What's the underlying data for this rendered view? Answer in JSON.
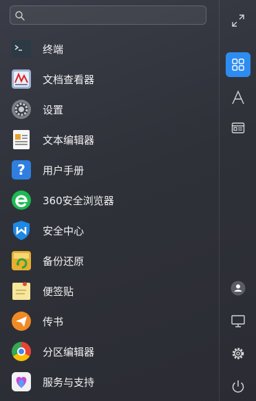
{
  "search": {
    "placeholder": "",
    "value": ""
  },
  "apps": [
    {
      "label": "终端",
      "icon": "terminal-icon"
    },
    {
      "label": "文档查看器",
      "icon": "document-viewer-icon"
    },
    {
      "label": "设置",
      "icon": "settings-gear-icon"
    },
    {
      "label": "文本编辑器",
      "icon": "text-editor-icon"
    },
    {
      "label": "用户手册",
      "icon": "help-manual-icon"
    },
    {
      "label": "360安全浏览器",
      "icon": "360-browser-icon"
    },
    {
      "label": "安全中心",
      "icon": "security-center-icon"
    },
    {
      "label": "备份还原",
      "icon": "backup-restore-icon"
    },
    {
      "label": "便签贴",
      "icon": "sticky-note-icon"
    },
    {
      "label": "传书",
      "icon": "transfer-icon"
    },
    {
      "label": "分区编辑器",
      "icon": "partition-editor-icon"
    },
    {
      "label": "服务与支持",
      "icon": "service-support-icon"
    }
  ],
  "sidebar": {
    "buttons": [
      {
        "icon": "expand-icon",
        "active": false
      },
      {
        "icon": "grid-view-icon",
        "active": true
      },
      {
        "icon": "letter-a-icon",
        "active": false
      },
      {
        "icon": "category-view-icon",
        "active": false
      },
      {
        "icon": "user-icon",
        "active": false
      },
      {
        "icon": "monitor-icon",
        "active": false
      },
      {
        "icon": "gear-icon",
        "active": false
      },
      {
        "icon": "power-icon",
        "active": false
      }
    ]
  },
  "colors": {
    "accent": "#2d8cf0",
    "background": "#2f3139",
    "text": "#f2f2f2"
  }
}
